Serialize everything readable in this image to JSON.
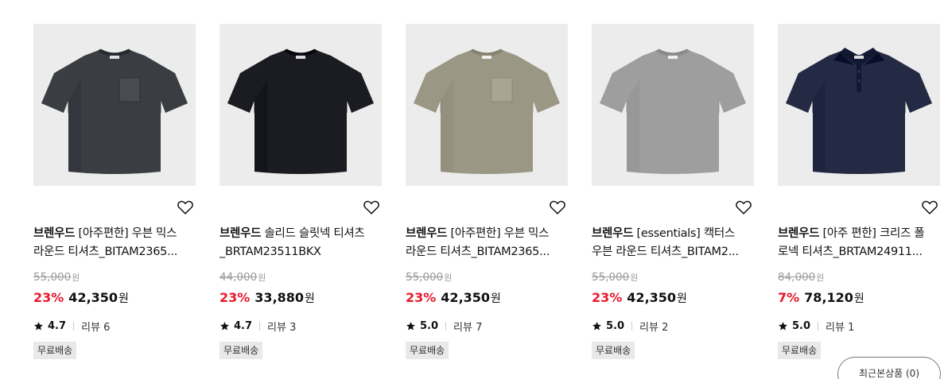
{
  "products": [
    {
      "brand": "브렌우드",
      "title_line1_rest": " [아주편한] 우븐 믹스",
      "title_line2": "라운드 티셔츠_BITAM2365...",
      "original_price": "55,000",
      "currency": "원",
      "discount_rate": "23%",
      "sale_price": "42,350",
      "rating": "4.7",
      "reviews": "리뷰 6",
      "badge": "무료배송",
      "shirt_color": "#3a3d42",
      "shirt_type": "crew-pocket"
    },
    {
      "brand": "브렌우드",
      "title_line1_rest": " 솔리드 슬릿넥 티셔츠",
      "title_line2": "_BRTAM23511BKX",
      "original_price": "44,000",
      "currency": "원",
      "discount_rate": "23%",
      "sale_price": "33,880",
      "rating": "4.7",
      "reviews": "리뷰 3",
      "badge": "무료배송",
      "shirt_color": "#1b1c22",
      "shirt_type": "crew"
    },
    {
      "brand": "브렌우드",
      "title_line1_rest": " [아주편한] 우븐 믹스",
      "title_line2": "라운드 티셔츠_BITAM2365...",
      "original_price": "55,000",
      "currency": "원",
      "discount_rate": "23%",
      "sale_price": "42,350",
      "rating": "5.0",
      "reviews": "리뷰 7",
      "badge": "무료배송",
      "shirt_color": "#9b9785",
      "shirt_type": "crew-pocket"
    },
    {
      "brand": "브렌우드",
      "title_line1_rest": " [essentials] 캑터스",
      "title_line2": "우븐 라운드 티셔츠_BITAM2...",
      "original_price": "55,000",
      "currency": "원",
      "discount_rate": "23%",
      "sale_price": "42,350",
      "rating": "5.0",
      "reviews": "리뷰 2",
      "badge": "무료배송",
      "shirt_color": "#9e9e9e",
      "shirt_type": "crew"
    },
    {
      "brand": "브렌우드",
      "title_line1_rest": " [아주 편한] 크리즈 폴",
      "title_line2": "로넥 티셔츠_BRTAM24911...",
      "original_price": "84,000",
      "currency": "원",
      "discount_rate": "7%",
      "sale_price": "78,120",
      "rating": "5.0",
      "reviews": "리뷰 1",
      "badge": "무료배송",
      "shirt_color": "#252a44",
      "shirt_type": "polo"
    }
  ],
  "recent_button": "최근본상품 (0)",
  "colors": {
    "discount": "#e8192c",
    "badge_bg": "#e9e9e9"
  }
}
